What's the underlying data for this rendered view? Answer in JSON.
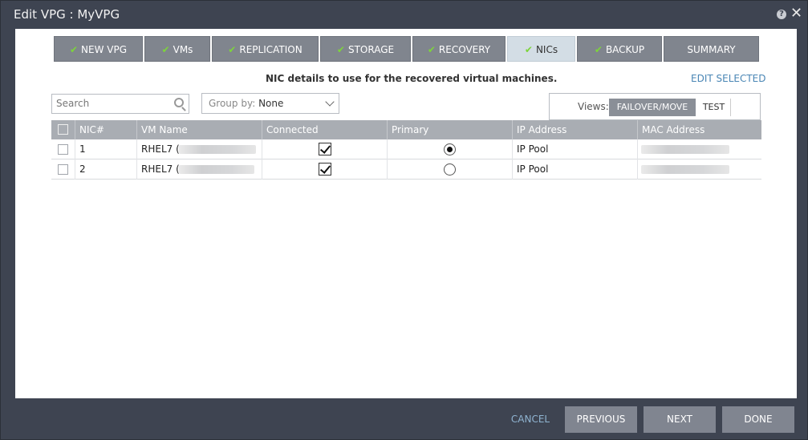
{
  "window": {
    "title": "Edit VPG : MyVPG",
    "help": "?",
    "close": "✕"
  },
  "tabs": [
    {
      "label": "NEW VPG",
      "checked": true,
      "active": false
    },
    {
      "label": "VMs",
      "checked": true,
      "active": false
    },
    {
      "label": "REPLICATION",
      "checked": true,
      "active": false
    },
    {
      "label": "STORAGE",
      "checked": true,
      "active": false
    },
    {
      "label": "RECOVERY",
      "checked": true,
      "active": false
    },
    {
      "label": "NICs",
      "checked": true,
      "active": true
    },
    {
      "label": "BACKUP",
      "checked": true,
      "active": false
    },
    {
      "label": "SUMMARY",
      "checked": false,
      "active": false
    }
  ],
  "subtitle": "NIC details to use for the recovered virtual machines.",
  "edit_selected": "EDIT SELECTED",
  "search": {
    "placeholder": "Search",
    "value": ""
  },
  "groupby": {
    "label": "Group by:",
    "value": "None"
  },
  "views": {
    "label": "Views:",
    "options": [
      "FAILOVER/MOVE",
      "TEST"
    ],
    "selected": "FAILOVER/MOVE"
  },
  "table": {
    "columns": [
      "NIC#",
      "VM Name",
      "Connected",
      "Primary",
      "IP Address",
      "MAC Address"
    ],
    "rows": [
      {
        "nic": "1",
        "vm": "RHEL7 (",
        "connected": true,
        "primary": true,
        "ip": "IP Pool"
      },
      {
        "nic": "2",
        "vm": "RHEL7 (",
        "connected": true,
        "primary": false,
        "ip": "IP Pool"
      }
    ]
  },
  "footer": {
    "cancel": "CANCEL",
    "previous": "PREVIOUS",
    "next": "NEXT",
    "done": "DONE"
  },
  "colors": {
    "accent_check": "#7dd43b",
    "link": "#4a86b5",
    "chrome": "#3e4451"
  }
}
